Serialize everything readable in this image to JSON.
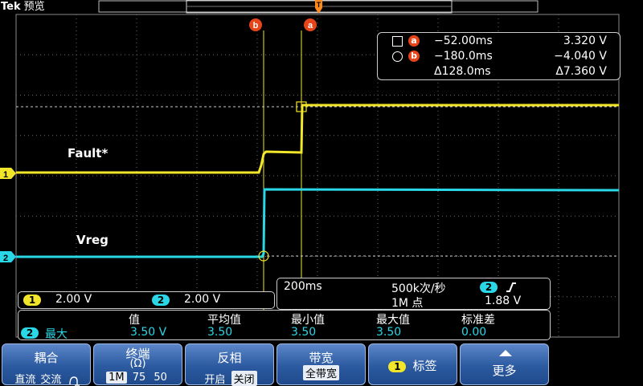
{
  "header": {
    "brand": "Tek",
    "mode": "预览"
  },
  "traces": {
    "ch1_label": "Fault*",
    "ch2_label": "Vreg"
  },
  "colors": {
    "ch1": "#f2e62a",
    "ch2": "#2ad7e6",
    "cursor_badge": "#e8441a",
    "menu": "#2c5aa0"
  },
  "cursor_badges": {
    "a": "a",
    "b": "b"
  },
  "cursor_readout": {
    "row_a": {
      "time": "−52.00ms",
      "value": "3.320 V"
    },
    "row_b": {
      "time": "−180.0ms",
      "value": "−4.040 V"
    },
    "row_delta": {
      "time": "Δ128.0ms",
      "value": "Δ7.360 V"
    }
  },
  "channel_scale": {
    "ch1": {
      "num": "1",
      "scale": "2.00 V"
    },
    "ch2": {
      "num": "2",
      "scale": "2.00 V"
    }
  },
  "timebase": {
    "time_div": "200ms",
    "sample_rate": "500k次/秒",
    "record": "1M 点",
    "trigger_source": "2",
    "trigger_level": "1.88 V"
  },
  "measurements": {
    "headers": [
      "值",
      "平均值",
      "最小值",
      "最大值",
      "标准差"
    ],
    "row": {
      "ch": "2",
      "name": "最大",
      "values": [
        "3.50 V",
        "3.50",
        "3.50",
        "3.50",
        "0.00"
      ]
    }
  },
  "menu": {
    "coupling": {
      "title": "耦合",
      "options": [
        "直流",
        "交流"
      ]
    },
    "termination": {
      "title": "终端",
      "unit": "(Ω)",
      "options": [
        "1M",
        "75",
        "50"
      ]
    },
    "invert": {
      "title": "反相",
      "options": [
        "开启",
        "关闭"
      ]
    },
    "bandwidth": {
      "title": "带宽",
      "value": "全带宽"
    },
    "label": {
      "ch": "1",
      "title": "标签"
    },
    "more": {
      "title": "更多"
    }
  }
}
